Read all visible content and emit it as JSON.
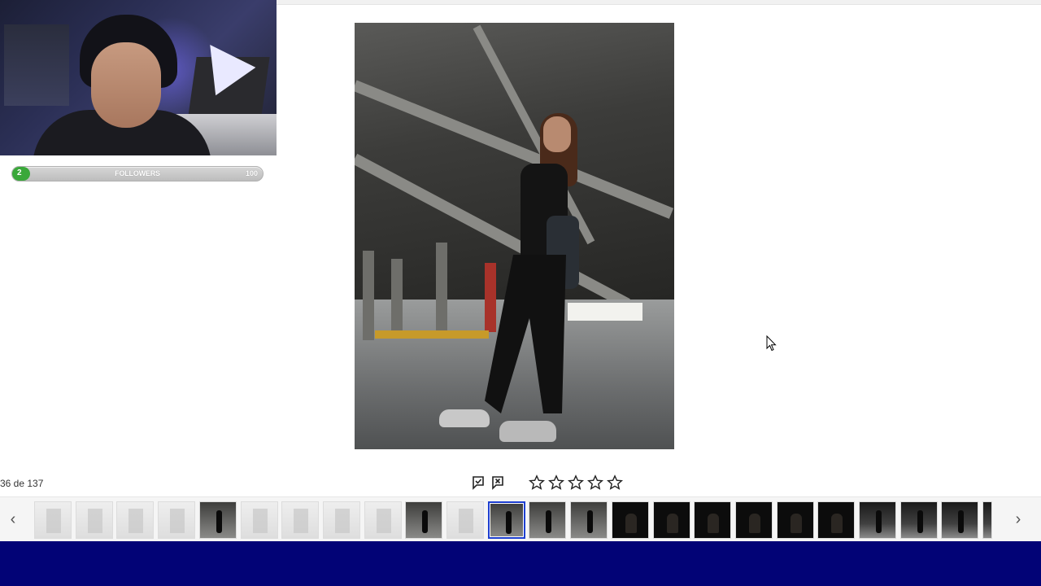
{
  "overlay": {
    "followers": {
      "count": "2",
      "label": "FOLLOWERS",
      "goal": "100",
      "progress": 0.02,
      "fill_color": "#3aa83a"
    }
  },
  "viewer": {
    "counter": "36 de 137",
    "flag_icons": [
      "flag-pick-icon",
      "flag-reject-icon"
    ],
    "rating": {
      "max": 5,
      "value": 0
    }
  },
  "filmstrip": {
    "prev_icon": "chevron-left-icon",
    "next_icon": "chevron-right-icon",
    "prev_label": "‹",
    "next_label": "›",
    "selected_index": 11,
    "thumbnails": [
      "blank",
      "blank",
      "blank",
      "blank",
      "garage",
      "blank",
      "blank",
      "blank",
      "blank",
      "garage",
      "blank",
      "garage",
      "garage",
      "garage",
      "dark",
      "dark",
      "dark",
      "dark",
      "dark",
      "dark",
      "road",
      "road",
      "road",
      "road"
    ]
  },
  "colors": {
    "footer_band": "#020376",
    "selection_border": "#1e3fd0"
  }
}
